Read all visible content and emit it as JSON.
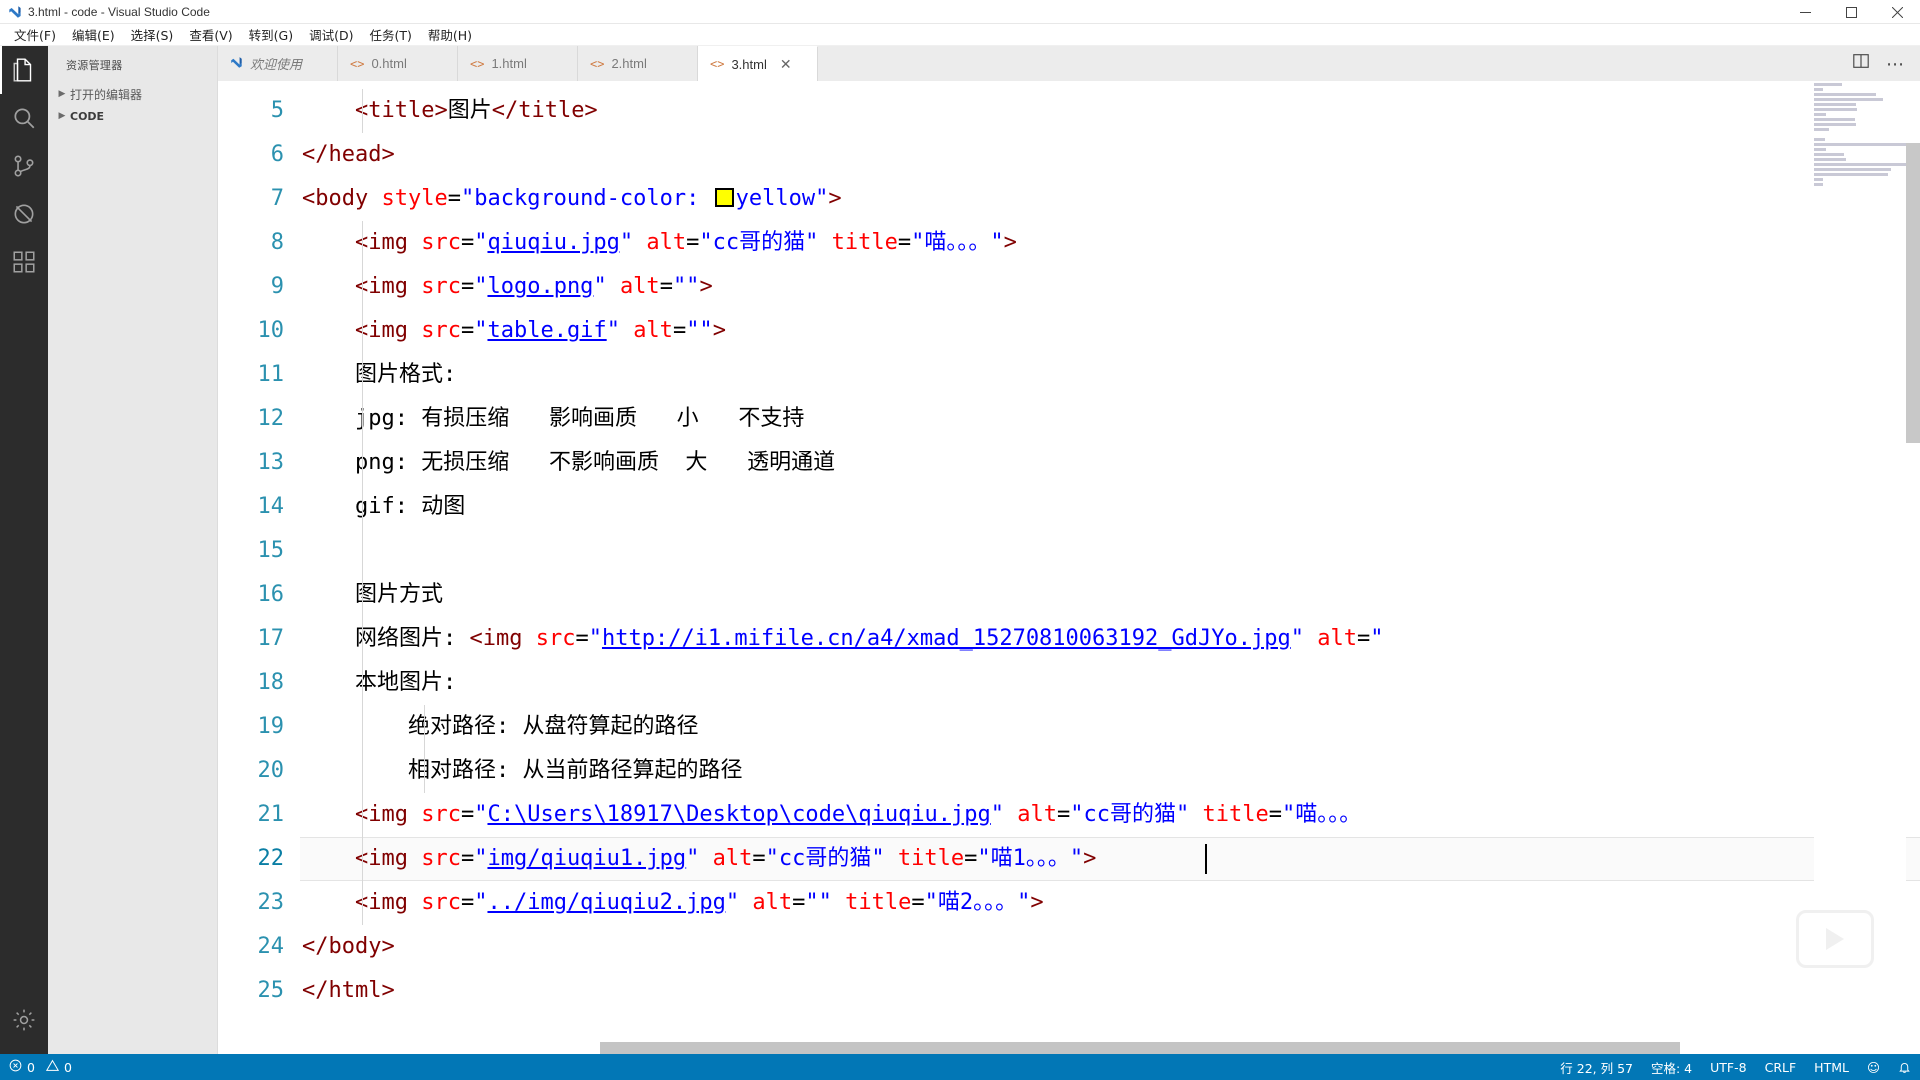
{
  "window": {
    "title": "3.html - code - Visual Studio Code",
    "app_icon": "vscode-logo-icon",
    "controls": {
      "minimize": "minimize-icon",
      "maximize": "maximize-icon",
      "close": "close-icon"
    }
  },
  "menubar": {
    "items": [
      {
        "label": "文件(F)"
      },
      {
        "label": "编辑(E)"
      },
      {
        "label": "选择(S)"
      },
      {
        "label": "查看(V)"
      },
      {
        "label": "转到(G)"
      },
      {
        "label": "调试(D)"
      },
      {
        "label": "任务(T)"
      },
      {
        "label": "帮助(H)"
      }
    ]
  },
  "activitybar": {
    "items": [
      {
        "icon": "files-explorer-icon",
        "active": true
      },
      {
        "icon": "search-icon",
        "active": false
      },
      {
        "icon": "source-control-icon",
        "active": false
      },
      {
        "icon": "run-debug-disabled-icon",
        "active": false
      },
      {
        "icon": "extensions-icon",
        "active": false
      }
    ],
    "bottom": [
      {
        "icon": "settings-gear-icon",
        "active": false
      }
    ]
  },
  "sidebar": {
    "title": "资源管理器",
    "sections": [
      {
        "label": "打开的编辑器",
        "expanded": false,
        "twisty": "chevron-right-icon"
      },
      {
        "label": "CODE",
        "expanded": false,
        "twisty": "chevron-right-icon"
      }
    ]
  },
  "tabs": {
    "items": [
      {
        "label": "欢迎使用",
        "icon": "vscode-logo-icon",
        "active": false,
        "italic": true,
        "closable": false
      },
      {
        "label": "0.html",
        "icon": "html-file-icon",
        "active": false,
        "italic": false,
        "closable": false
      },
      {
        "label": "1.html",
        "icon": "html-file-icon",
        "active": false,
        "italic": false,
        "closable": false
      },
      {
        "label": "2.html",
        "icon": "html-file-icon",
        "active": false,
        "italic": false,
        "closable": false
      },
      {
        "label": "3.html",
        "icon": "html-file-icon",
        "active": true,
        "italic": false,
        "closable": true,
        "close_glyph": "✕"
      }
    ],
    "actions": [
      {
        "icon": "split-editor-icon"
      },
      {
        "icon": "more-actions-icon",
        "glyph": "⋯"
      }
    ]
  },
  "editor": {
    "first_line_number": 5,
    "current_line_number": 22,
    "lines": [
      {
        "n": 5,
        "indent_guides": 1,
        "tokens": [
          {
            "t": "plain",
            "v": "    "
          },
          {
            "t": "tag",
            "v": "<title>"
          },
          {
            "t": "text",
            "v": "图片"
          },
          {
            "t": "tag",
            "v": "</title>"
          }
        ]
      },
      {
        "n": 6,
        "indent_guides": 0,
        "tokens": [
          {
            "t": "tag",
            "v": "</head>"
          }
        ]
      },
      {
        "n": 7,
        "indent_guides": 0,
        "tokens": [
          {
            "t": "tag",
            "v": "<body "
          },
          {
            "t": "attr",
            "v": "style"
          },
          {
            "t": "eq",
            "v": "="
          },
          {
            "t": "val",
            "v": "\"background-color: "
          },
          {
            "t": "swatch",
            "v": "#ffff00"
          },
          {
            "t": "val",
            "v": "yellow\""
          },
          {
            "t": "tag",
            "v": ">"
          }
        ]
      },
      {
        "n": 8,
        "indent_guides": 1,
        "tokens": [
          {
            "t": "plain",
            "v": "    "
          },
          {
            "t": "tag",
            "v": "<img "
          },
          {
            "t": "attr",
            "v": "src"
          },
          {
            "t": "eq",
            "v": "="
          },
          {
            "t": "val",
            "v": "\""
          },
          {
            "t": "link",
            "v": "qiuqiu.jpg"
          },
          {
            "t": "val",
            "v": "\""
          },
          {
            "t": "plain",
            "v": " "
          },
          {
            "t": "attr",
            "v": "alt"
          },
          {
            "t": "eq",
            "v": "="
          },
          {
            "t": "val",
            "v": "\"cc哥的猫\""
          },
          {
            "t": "plain",
            "v": " "
          },
          {
            "t": "attr",
            "v": "title"
          },
          {
            "t": "eq",
            "v": "="
          },
          {
            "t": "val",
            "v": "\"喵。。。\""
          },
          {
            "t": "tag",
            "v": ">"
          }
        ]
      },
      {
        "n": 9,
        "indent_guides": 1,
        "tokens": [
          {
            "t": "plain",
            "v": "    "
          },
          {
            "t": "tag",
            "v": "<img "
          },
          {
            "t": "attr",
            "v": "src"
          },
          {
            "t": "eq",
            "v": "="
          },
          {
            "t": "val",
            "v": "\""
          },
          {
            "t": "link",
            "v": "logo.png"
          },
          {
            "t": "val",
            "v": "\""
          },
          {
            "t": "plain",
            "v": " "
          },
          {
            "t": "attr",
            "v": "alt"
          },
          {
            "t": "eq",
            "v": "="
          },
          {
            "t": "val",
            "v": "\"\""
          },
          {
            "t": "tag",
            "v": ">"
          }
        ]
      },
      {
        "n": 10,
        "indent_guides": 1,
        "tokens": [
          {
            "t": "plain",
            "v": "    "
          },
          {
            "t": "tag",
            "v": "<img "
          },
          {
            "t": "attr",
            "v": "src"
          },
          {
            "t": "eq",
            "v": "="
          },
          {
            "t": "val",
            "v": "\""
          },
          {
            "t": "link",
            "v": "table.gif"
          },
          {
            "t": "val",
            "v": "\""
          },
          {
            "t": "plain",
            "v": " "
          },
          {
            "t": "attr",
            "v": "alt"
          },
          {
            "t": "eq",
            "v": "="
          },
          {
            "t": "val",
            "v": "\"\""
          },
          {
            "t": "tag",
            "v": ">"
          }
        ]
      },
      {
        "n": 11,
        "indent_guides": 1,
        "tokens": [
          {
            "t": "plain",
            "v": "    "
          },
          {
            "t": "text",
            "v": "图片格式:"
          }
        ]
      },
      {
        "n": 12,
        "indent_guides": 1,
        "tokens": [
          {
            "t": "plain",
            "v": "    "
          },
          {
            "t": "text",
            "v": "jpg: 有损压缩   影响画质   小   不支持"
          }
        ]
      },
      {
        "n": 13,
        "indent_guides": 1,
        "tokens": [
          {
            "t": "plain",
            "v": "    "
          },
          {
            "t": "text",
            "v": "png: 无损压缩   不影响画质  大   透明通道"
          }
        ]
      },
      {
        "n": 14,
        "indent_guides": 1,
        "tokens": [
          {
            "t": "plain",
            "v": "    "
          },
          {
            "t": "text",
            "v": "gif: 动图"
          }
        ]
      },
      {
        "n": 15,
        "indent_guides": 1,
        "tokens": []
      },
      {
        "n": 16,
        "indent_guides": 1,
        "tokens": [
          {
            "t": "plain",
            "v": "    "
          },
          {
            "t": "text",
            "v": "图片方式"
          }
        ]
      },
      {
        "n": 17,
        "indent_guides": 1,
        "tokens": [
          {
            "t": "plain",
            "v": "    "
          },
          {
            "t": "text",
            "v": "网络图片: "
          },
          {
            "t": "tag",
            "v": "<img "
          },
          {
            "t": "attr",
            "v": "src"
          },
          {
            "t": "eq",
            "v": "="
          },
          {
            "t": "val",
            "v": "\""
          },
          {
            "t": "link",
            "v": "http://i1.mifile.cn/a4/xmad_15270810063192_GdJYo.jpg"
          },
          {
            "t": "val",
            "v": "\""
          },
          {
            "t": "plain",
            "v": " "
          },
          {
            "t": "attr",
            "v": "alt"
          },
          {
            "t": "eq",
            "v": "="
          },
          {
            "t": "val",
            "v": "\""
          }
        ]
      },
      {
        "n": 18,
        "indent_guides": 1,
        "tokens": [
          {
            "t": "plain",
            "v": "    "
          },
          {
            "t": "text",
            "v": "本地图片:"
          }
        ]
      },
      {
        "n": 19,
        "indent_guides": 2,
        "tokens": [
          {
            "t": "plain",
            "v": "        "
          },
          {
            "t": "text",
            "v": "绝对路径: 从盘符算起的路径"
          }
        ]
      },
      {
        "n": 20,
        "indent_guides": 2,
        "tokens": [
          {
            "t": "plain",
            "v": "        "
          },
          {
            "t": "text",
            "v": "相对路径: 从当前路径算起的路径"
          }
        ]
      },
      {
        "n": 21,
        "indent_guides": 1,
        "tokens": [
          {
            "t": "plain",
            "v": "    "
          },
          {
            "t": "tag",
            "v": "<img "
          },
          {
            "t": "attr",
            "v": "src"
          },
          {
            "t": "eq",
            "v": "="
          },
          {
            "t": "val",
            "v": "\""
          },
          {
            "t": "link",
            "v": "C:\\Users\\18917\\Desktop\\code\\qiuqiu.jpg"
          },
          {
            "t": "val",
            "v": "\""
          },
          {
            "t": "plain",
            "v": " "
          },
          {
            "t": "attr",
            "v": "alt"
          },
          {
            "t": "eq",
            "v": "="
          },
          {
            "t": "val",
            "v": "\"cc哥的猫\""
          },
          {
            "t": "plain",
            "v": " "
          },
          {
            "t": "attr",
            "v": "title"
          },
          {
            "t": "eq",
            "v": "="
          },
          {
            "t": "val",
            "v": "\"喵。。。"
          }
        ]
      },
      {
        "n": 22,
        "indent_guides": 1,
        "current": true,
        "tokens": [
          {
            "t": "plain",
            "v": "    "
          },
          {
            "t": "tag",
            "v": "<img "
          },
          {
            "t": "attr",
            "v": "src"
          },
          {
            "t": "eq",
            "v": "="
          },
          {
            "t": "val",
            "v": "\""
          },
          {
            "t": "link",
            "v": "img/qiuqiu1.jpg"
          },
          {
            "t": "val",
            "v": "\""
          },
          {
            "t": "plain",
            "v": " "
          },
          {
            "t": "attr",
            "v": "alt"
          },
          {
            "t": "eq",
            "v": "="
          },
          {
            "t": "val",
            "v": "\"cc哥的猫\""
          },
          {
            "t": "plain",
            "v": " "
          },
          {
            "t": "attr",
            "v": "title"
          },
          {
            "t": "eq",
            "v": "="
          },
          {
            "t": "val",
            "v": "\"喵1。。。\""
          },
          {
            "t": "tag",
            "v": ">"
          }
        ]
      },
      {
        "n": 23,
        "indent_guides": 1,
        "tokens": [
          {
            "t": "plain",
            "v": "    "
          },
          {
            "t": "tag",
            "v": "<img "
          },
          {
            "t": "attr",
            "v": "src"
          },
          {
            "t": "eq",
            "v": "="
          },
          {
            "t": "val",
            "v": "\""
          },
          {
            "t": "link",
            "v": "../img/qiuqiu2.jpg"
          },
          {
            "t": "val",
            "v": "\""
          },
          {
            "t": "plain",
            "v": " "
          },
          {
            "t": "attr",
            "v": "alt"
          },
          {
            "t": "eq",
            "v": "="
          },
          {
            "t": "val",
            "v": "\"\""
          },
          {
            "t": "plain",
            "v": " "
          },
          {
            "t": "attr",
            "v": "title"
          },
          {
            "t": "eq",
            "v": "="
          },
          {
            "t": "val",
            "v": "\"喵2。。。\""
          },
          {
            "t": "tag",
            "v": ">"
          }
        ]
      },
      {
        "n": 24,
        "indent_guides": 0,
        "tokens": [
          {
            "t": "tag",
            "v": "</body>"
          }
        ]
      },
      {
        "n": 25,
        "indent_guides": 0,
        "tokens": [
          {
            "t": "tag",
            "v": "</html>"
          }
        ]
      }
    ]
  },
  "statusbar": {
    "left": [
      {
        "name": "errors-warnings",
        "icon": "error-icon",
        "text": "0",
        "icon2": "warning-icon",
        "text2": "0"
      }
    ],
    "right": [
      {
        "name": "cursor-position",
        "text": "行 22, 列 57"
      },
      {
        "name": "indentation",
        "text": "空格: 4"
      },
      {
        "name": "encoding",
        "text": "UTF-8"
      },
      {
        "name": "eol",
        "text": "CRLF"
      },
      {
        "name": "language-mode",
        "text": "HTML"
      },
      {
        "name": "feedback",
        "text": "☺"
      },
      {
        "name": "notifications",
        "text": "🔔"
      }
    ],
    "background": "#0277b6"
  },
  "colors": {
    "tag": "#800000",
    "attribute": "#ff0000",
    "value": "#0000ff",
    "linenumber": "#2b91af",
    "statusbar": "#0277b6",
    "activitybar": "#2c2c2c",
    "sidebar": "#e8e8e8",
    "swatch_yellow": "#ffff00"
  }
}
